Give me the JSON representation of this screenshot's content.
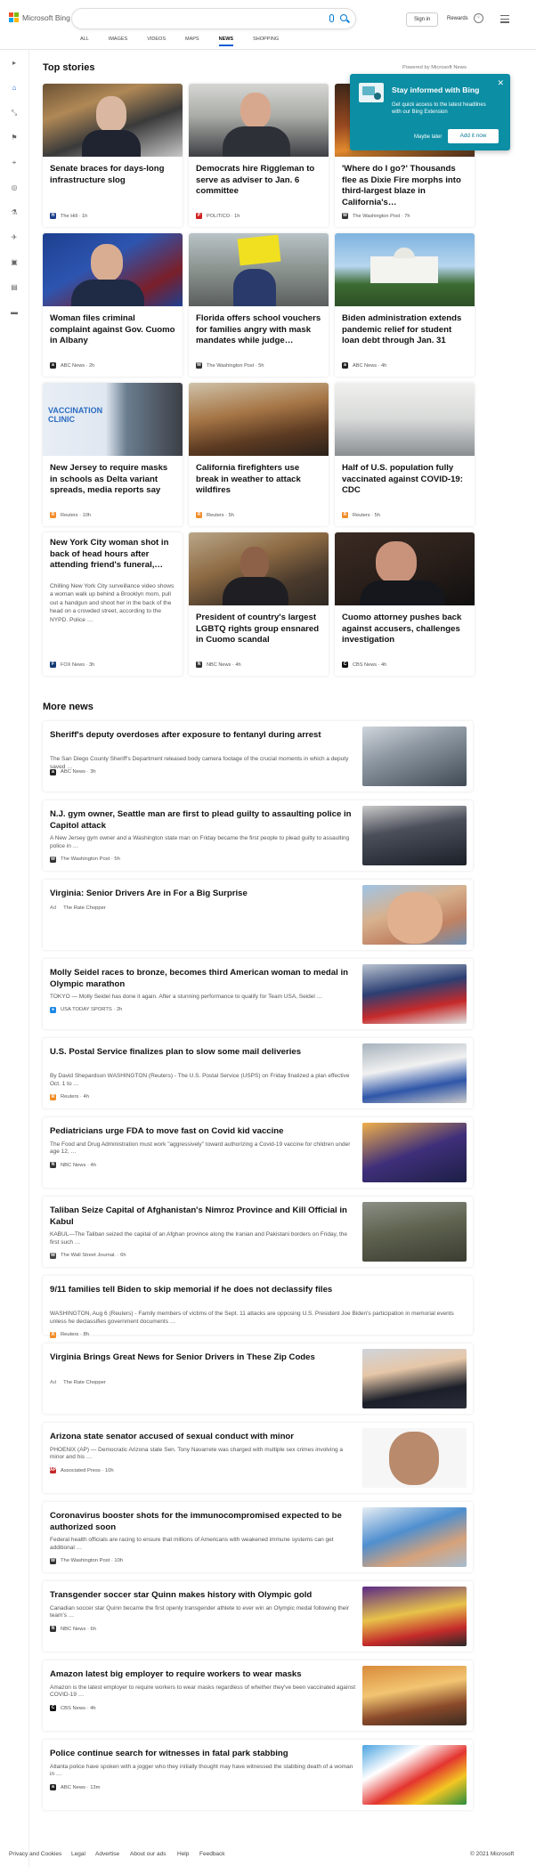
{
  "header": {
    "brand": "Microsoft Bing",
    "signin": "Sign in",
    "rewards": "Rewards",
    "tabs": [
      "ALL",
      "IMAGES",
      "VIDEOS",
      "MAPS",
      "NEWS",
      "SHOPPING"
    ],
    "active_tab": "NEWS",
    "accent": "#0078d4"
  },
  "top_stories": {
    "heading": "Top stories",
    "powered": "Powered by Microsoft News",
    "cards": [
      {
        "title": "Senate braces for days-long infrastructure slog",
        "source": "The Hill",
        "time": "1h"
      },
      {
        "title": "Democrats hire Riggleman to serve as adviser to Jan. 6 committee",
        "source": "POLITICO",
        "time": "1h"
      },
      {
        "title": "'Where do I go?' Thousands flee as Dixie Fire morphs into third-largest blaze in California's…",
        "source": "The Washington Post",
        "time": "7h"
      },
      {
        "title": "Woman files criminal complaint against Gov. Cuomo in Albany",
        "source": "ABC News",
        "time": "2h"
      },
      {
        "title": "Florida offers school vouchers for families angry with mask mandates while judge…",
        "source": "The Washington Post",
        "time": "5h"
      },
      {
        "title": "Biden administration extends pandemic relief for student loan debt through Jan. 31",
        "source": "ABC News",
        "time": "4h"
      },
      {
        "title": "New Jersey to require masks in schools as Delta variant spreads, media reports say",
        "source": "Reuters",
        "time": "10h"
      },
      {
        "title": "California firefighters use break in weather to attack wildfires",
        "source": "Reuters",
        "time": "5h"
      },
      {
        "title": "Half of U.S. population fully vaccinated against COVID-19: CDC",
        "source": "Reuters",
        "time": "5h"
      },
      {
        "title": "New York City woman shot in back of head hours after attending friend's funeral,…",
        "snippet": "Chilling New York City surveillance video shows a woman walk up behind a Brooklyn mom, pull out a handgun and shoot her in the back of the head on a crowded street, according to the NYPD. Police …",
        "source": "FOX News",
        "time": "3h"
      },
      {
        "title": "President of country's largest LGBTQ rights group ensnared in Cuomo scandal",
        "source": "NBC News",
        "time": "4h"
      },
      {
        "title": "Cuomo attorney pushes back against accusers, challenges investigation",
        "source": "CBS News",
        "time": "4h"
      }
    ]
  },
  "popup": {
    "title": "Stay informed with Bing",
    "body": "Get quick access to the latest headlines with our Bing Extension",
    "later": "Maybe later",
    "add": "Add it now",
    "close": "✕"
  },
  "more_news": {
    "heading": "More news",
    "items": [
      {
        "title": "Sheriff's deputy overdoses after exposure to fentanyl during arrest",
        "snippet": "The San Diego County Sheriff's Department released body camera footage of the crucial moments in which a deputy saved …",
        "source": "ABC News",
        "time": "3h"
      },
      {
        "title": "N.J. gym owner, Seattle man are first to plead guilty to assaulting police in Capitol attack",
        "snippet": "A New Jersey gym owner and a Washington state man on Friday became the first people to plead guilty to assaulting police in …",
        "source": "The Washington Post",
        "time": "5h"
      },
      {
        "title": "Virginia: Senior Drivers Are in For a Big Surprise",
        "snippet": "",
        "ad": "Ad",
        "source": "The Rate Chopper",
        "time": ""
      },
      {
        "title": "Molly Seidel races to bronze, becomes third American woman to medal in Olympic marathon",
        "snippet": "TOKYO — Molly Seidel has done it again. After a stunning performance to qualify for Team USA, Seidel …",
        "source": "USA TODAY SPORTS",
        "time": "2h"
      },
      {
        "title": "U.S. Postal Service finalizes plan to slow some mail deliveries",
        "snippet": "By David Shepardson WASHINGTON (Reuters) - The U.S. Postal Service (USPS) on Friday finalized a plan effective Oct. 1 to …",
        "source": "Reuters",
        "time": "4h"
      },
      {
        "title": "Pediatricians urge FDA to move fast on Covid kid vaccine",
        "snippet": "The Food and Drug Administration must work \"aggressively\" toward authorizing a Covid-19 vaccine for children under age 12, …",
        "source": "NBC News",
        "time": "4h"
      },
      {
        "title": "Taliban Seize Capital of Afghanistan's Nimroz Province and Kill Official in Kabul",
        "snippet": "KABUL—The Taliban seized the capital of an Afghan province along the Iranian and Pakistani borders on Friday, the first such …",
        "source": "The Wall Street Journal.",
        "time": "6h"
      },
      {
        "title": "9/11 families tell Biden to skip memorial if he does not declassify files",
        "snippet": "WASHINGTON, Aug 6 (Reuters) - Family members of victims of the Sept. 11 attacks are opposing U.S. President Joe Biden's participation in memorial events unless he declassifies government documents …",
        "source": "Reuters",
        "time": "8h"
      },
      {
        "title": "Virginia Brings Great News for Senior Drivers in These Zip Codes",
        "snippet": "",
        "ad": "Ad",
        "source": "The Rate Chopper",
        "time": ""
      },
      {
        "title": "Arizona state senator accused of sexual conduct with minor",
        "snippet": "PHOENIX (AP) — Democratic Arizona state Sen. Tony Navarrete was charged with multiple sex crimes involving a minor and his …",
        "source": "Associated Press",
        "time": "10h"
      },
      {
        "title": "Coronavirus booster shots for the immunocompromised expected to be authorized soon",
        "snippet": "Federal health officials are racing to ensure that millions of Americans with weakened immune systems can get additional …",
        "source": "The Washington Post",
        "time": "10h"
      },
      {
        "title": "Transgender soccer star Quinn makes history with Olympic gold",
        "snippet": "Canadian soccer star Quinn became the first openly transgender athlete to ever win an Olympic medal following their team's …",
        "source": "NBC News",
        "time": "6h"
      },
      {
        "title": "Amazon latest big employer to require workers to wear masks",
        "snippet": "Amazon is the latest employer to require workers to wear masks regardless of whether they've been vaccinated against COVID-19 …",
        "source": "CBS News",
        "time": "4h"
      },
      {
        "title": "Police continue search for witnesses in fatal park stabbing",
        "snippet": "Atlanta police have spoken with a jogger who they initially thought may have witnessed the stabbing death of a woman in …",
        "source": "ABC News",
        "time": "13m"
      }
    ]
  },
  "footer": {
    "links": [
      "Privacy and Cookies",
      "Legal",
      "Advertise",
      "About our ads",
      "Help",
      "Feedback"
    ],
    "copyright": "© 2021 Microsoft"
  }
}
